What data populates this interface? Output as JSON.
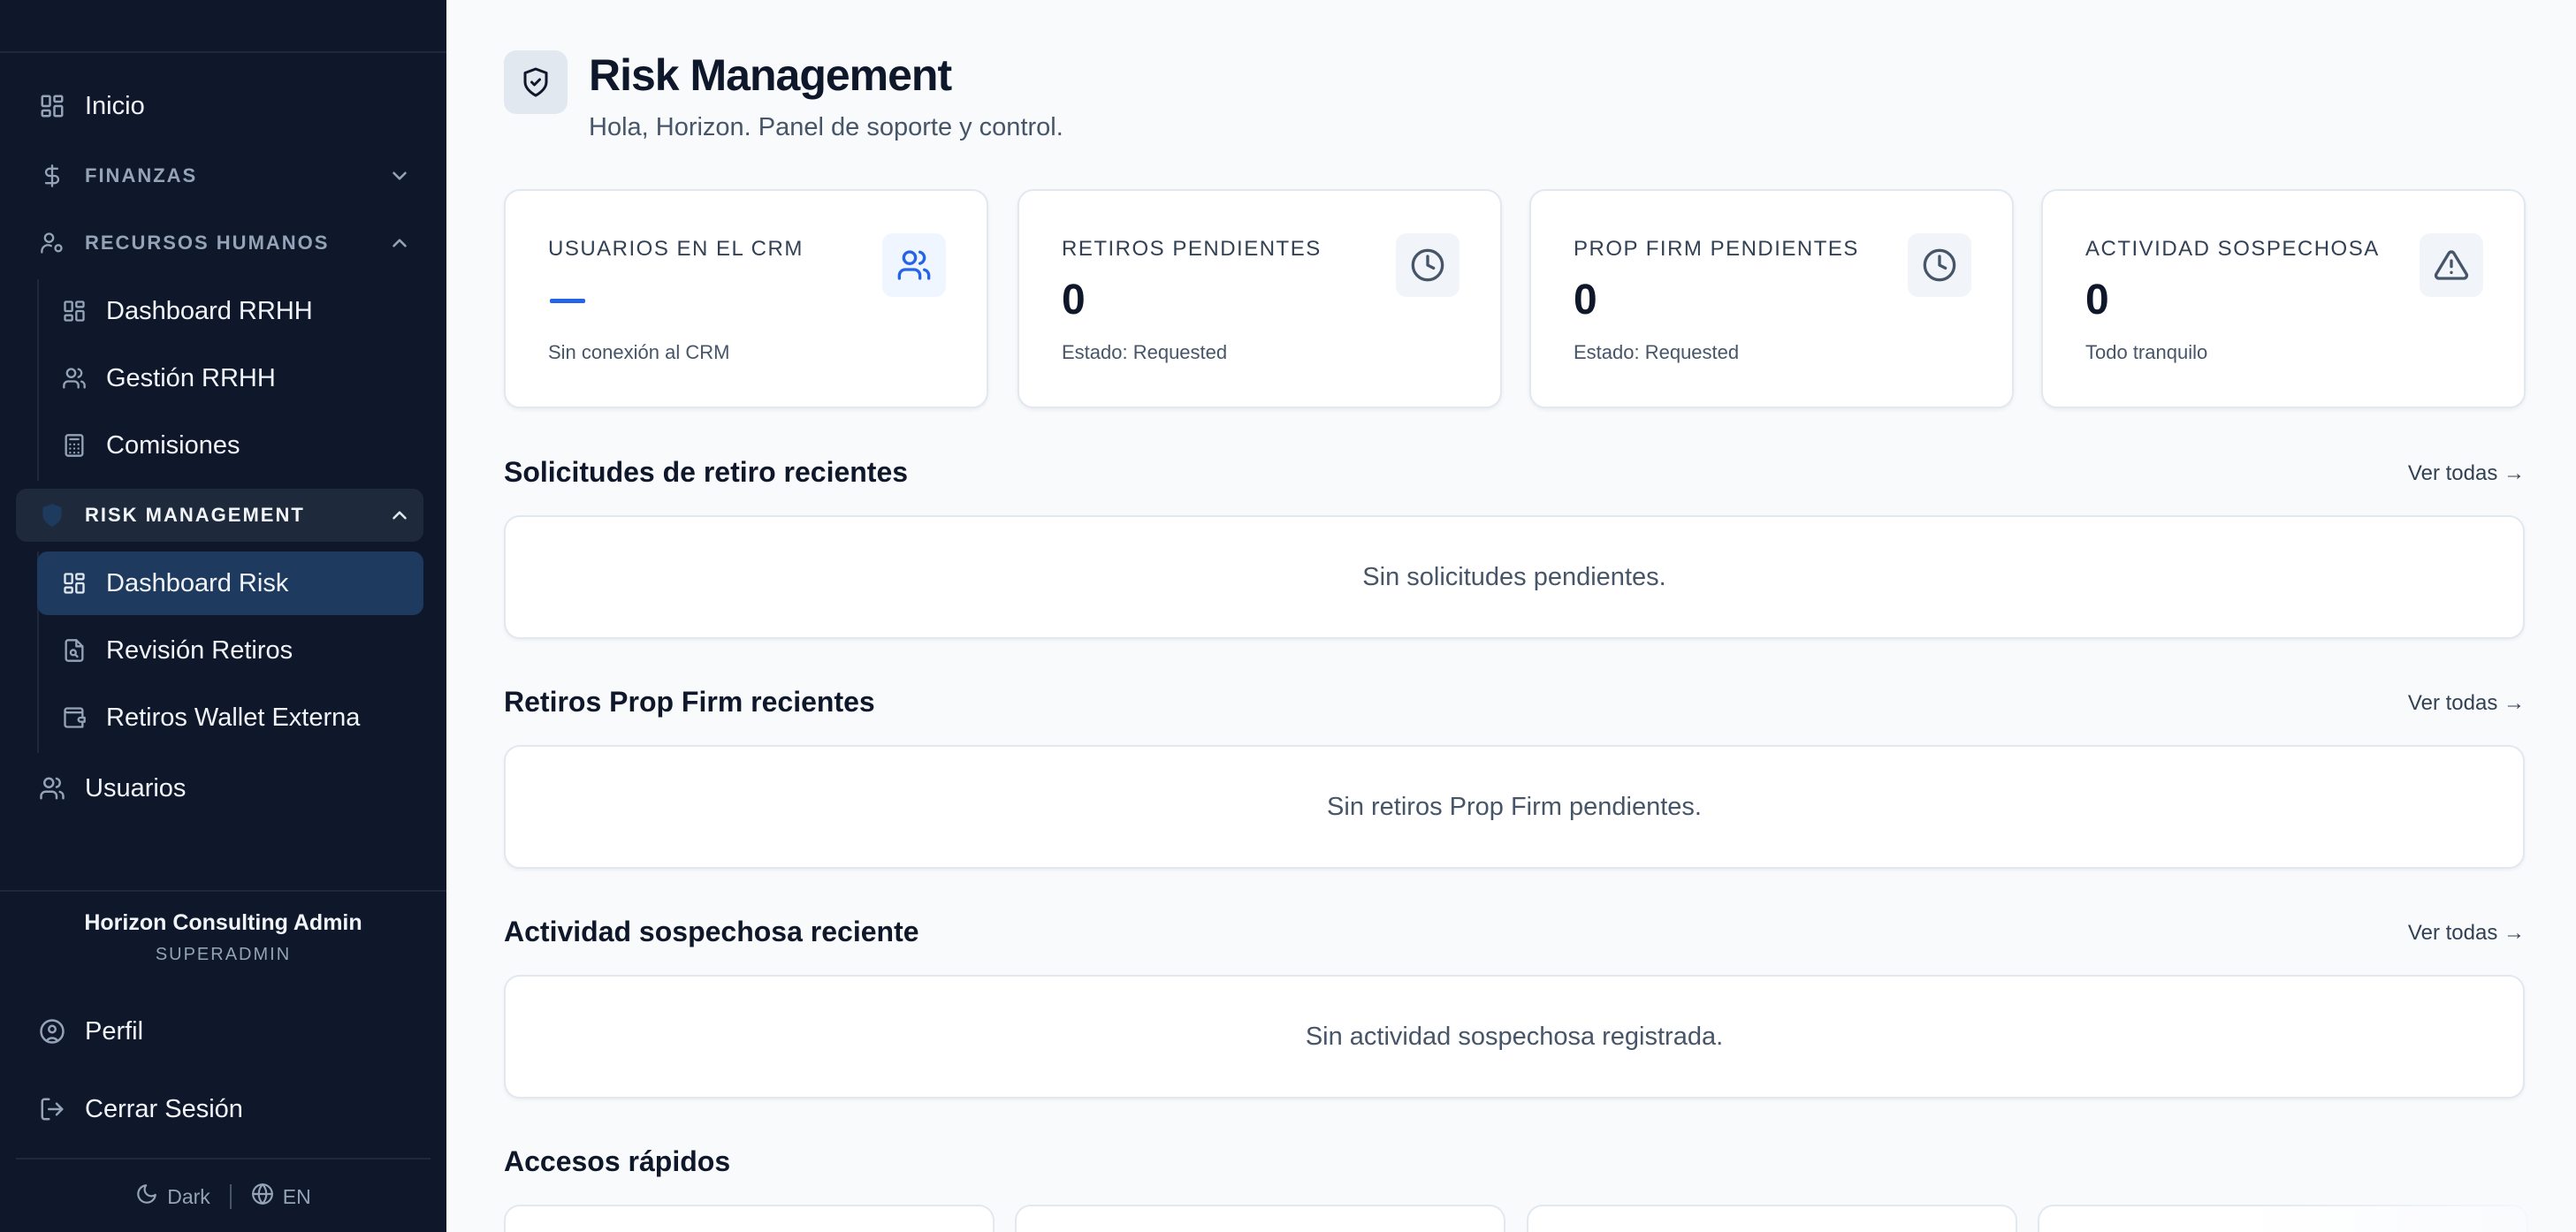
{
  "sidebar": {
    "items": {
      "inicio": "Inicio",
      "usuarios": "Usuarios",
      "perfil": "Perfil",
      "cerrar_sesion": "Cerrar Sesión"
    },
    "sections": {
      "finanzas": "FINANZAS",
      "rrhh": "RECURSOS HUMANOS",
      "risk": "RISK MANAGEMENT"
    },
    "rrhh_items": [
      "Dashboard RRHH",
      "Gestión RRHH",
      "Comisiones"
    ],
    "risk_items": [
      "Dashboard Risk",
      "Revisión Retiros",
      "Retiros Wallet Externa"
    ],
    "user": {
      "name": "Horizon Consulting Admin",
      "role": "SUPERADMIN"
    },
    "footer": {
      "theme": "Dark",
      "lang": "EN"
    }
  },
  "header": {
    "title": "Risk Management",
    "subtitle": "Hola, Horizon. Panel de soporte y control."
  },
  "stats": [
    {
      "label": "USUARIOS EN EL CRM",
      "value": "",
      "note": "Sin conexión al CRM",
      "icon": "users-icon"
    },
    {
      "label": "RETIROS PENDIENTES",
      "value": "0",
      "note": "Estado: Requested",
      "icon": "clock-icon"
    },
    {
      "label": "PROP FIRM PENDIENTES",
      "value": "0",
      "note": "Estado: Requested",
      "icon": "clock-icon"
    },
    {
      "label": "ACTIVIDAD SOSPECHOSA",
      "value": "0",
      "note": "Todo tranquilo",
      "icon": "alert-triangle-icon"
    }
  ],
  "sections": [
    {
      "title": "Solicitudes de retiro recientes",
      "link": "Ver todas →",
      "empty": "Sin solicitudes pendientes."
    },
    {
      "title": "Retiros Prop Firm recientes",
      "link": "Ver todas →",
      "empty": "Sin retiros Prop Firm pendientes."
    },
    {
      "title": "Actividad sospechosa reciente",
      "link": "Ver todas →",
      "empty": "Sin actividad sospechosa registrada."
    }
  ],
  "quick_access": {
    "title": "Accesos rápidos"
  },
  "colors": {
    "sidebar_bg": "#0f172a",
    "active_bg": "#1e3a5f",
    "accent": "#2563eb",
    "page_bg": "#f8fafc"
  }
}
